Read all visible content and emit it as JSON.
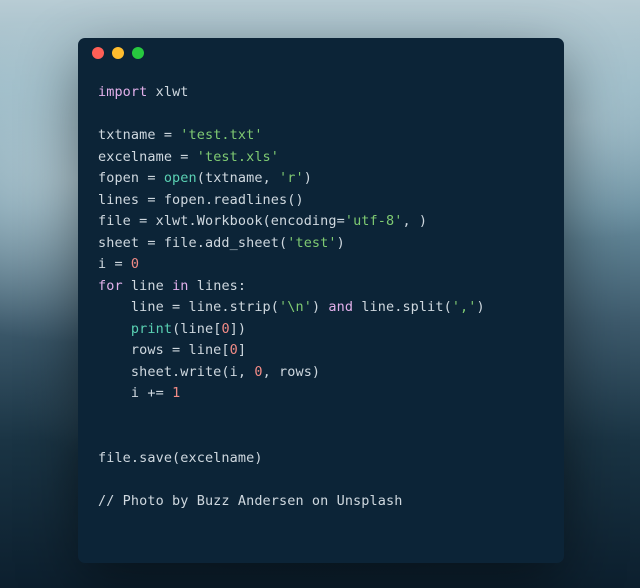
{
  "window": {
    "dots": [
      "red",
      "yellow",
      "green"
    ]
  },
  "code": {
    "tokens": [
      [
        {
          "c": "kw",
          "t": "import"
        },
        {
          "c": "plain",
          "t": " "
        },
        {
          "c": "mod",
          "t": "xlwt"
        }
      ],
      [],
      [
        {
          "c": "plain",
          "t": "txtname = "
        },
        {
          "c": "str",
          "t": "'test.txt'"
        }
      ],
      [
        {
          "c": "plain",
          "t": "excelname = "
        },
        {
          "c": "str",
          "t": "'test.xls'"
        }
      ],
      [
        {
          "c": "plain",
          "t": "fopen = "
        },
        {
          "c": "fn",
          "t": "open"
        },
        {
          "c": "plain",
          "t": "(txtname, "
        },
        {
          "c": "str",
          "t": "'r'"
        },
        {
          "c": "plain",
          "t": ")"
        }
      ],
      [
        {
          "c": "plain",
          "t": "lines = fopen.readlines()"
        }
      ],
      [
        {
          "c": "plain",
          "t": "file = xlwt.Workbook("
        },
        {
          "c": "plain",
          "t": "encoding="
        },
        {
          "c": "str",
          "t": "'utf-8'"
        },
        {
          "c": "plain",
          "t": ", )"
        }
      ],
      [
        {
          "c": "plain",
          "t": "sheet = file.add_sheet("
        },
        {
          "c": "str",
          "t": "'test'"
        },
        {
          "c": "plain",
          "t": ")"
        }
      ],
      [
        {
          "c": "plain",
          "t": "i = "
        },
        {
          "c": "num",
          "t": "0"
        }
      ],
      [
        {
          "c": "kw",
          "t": "for"
        },
        {
          "c": "plain",
          "t": " line "
        },
        {
          "c": "kw",
          "t": "in"
        },
        {
          "c": "plain",
          "t": " lines:"
        }
      ],
      [
        {
          "c": "plain",
          "t": "    line = line.strip("
        },
        {
          "c": "str",
          "t": "'\\n'"
        },
        {
          "c": "plain",
          "t": ") "
        },
        {
          "c": "kw",
          "t": "and"
        },
        {
          "c": "plain",
          "t": " line.split("
        },
        {
          "c": "str",
          "t": "','"
        },
        {
          "c": "plain",
          "t": ")"
        }
      ],
      [
        {
          "c": "plain",
          "t": "    "
        },
        {
          "c": "fn",
          "t": "print"
        },
        {
          "c": "plain",
          "t": "(line["
        },
        {
          "c": "num",
          "t": "0"
        },
        {
          "c": "plain",
          "t": "])"
        }
      ],
      [
        {
          "c": "plain",
          "t": "    rows = line["
        },
        {
          "c": "num",
          "t": "0"
        },
        {
          "c": "plain",
          "t": "]"
        }
      ],
      [
        {
          "c": "plain",
          "t": "    sheet.write(i, "
        },
        {
          "c": "num",
          "t": "0"
        },
        {
          "c": "plain",
          "t": ", rows)"
        }
      ],
      [
        {
          "c": "plain",
          "t": "    i += "
        },
        {
          "c": "num",
          "t": "1"
        }
      ],
      [],
      [],
      [
        {
          "c": "plain",
          "t": "file.save(excelname)"
        }
      ],
      [],
      [
        {
          "c": "cm",
          "t": "// Photo by Buzz Andersen on Unsplash"
        }
      ]
    ]
  }
}
